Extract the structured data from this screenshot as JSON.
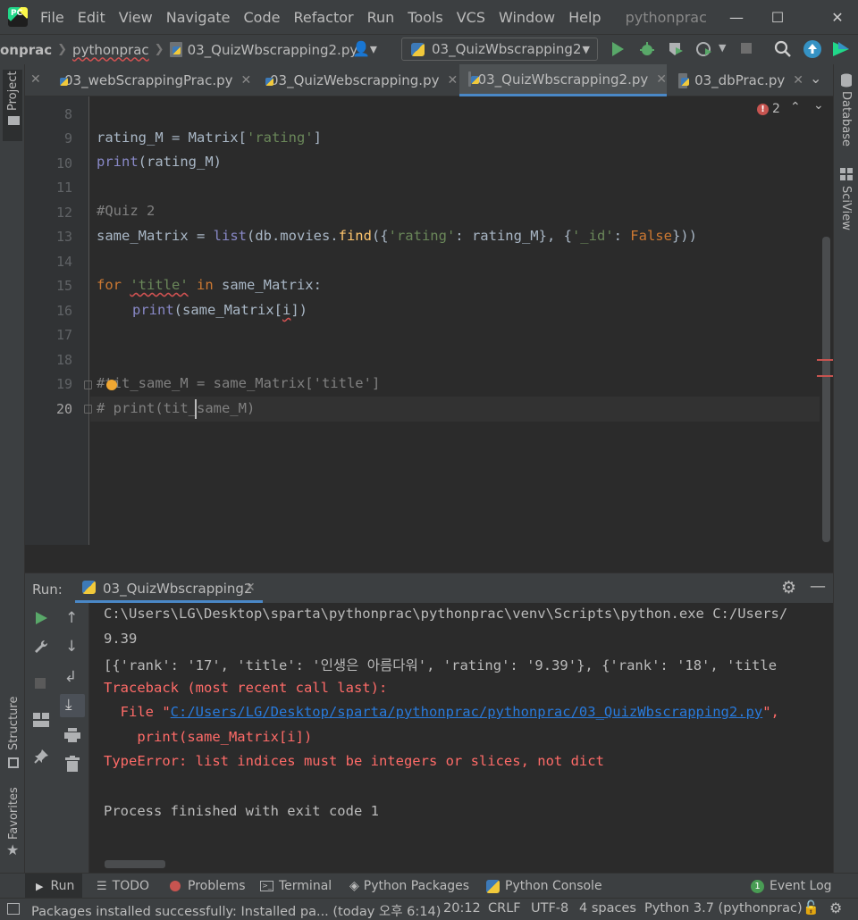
{
  "menubar": {
    "logo_text": "PC",
    "items": [
      "File",
      "Edit",
      "View",
      "Navigate",
      "Code",
      "Refactor",
      "Run",
      "Tools",
      "VCS",
      "Window",
      "Help"
    ],
    "mnemonics": [
      "F",
      "E",
      "V",
      "N",
      "C",
      "R",
      "R",
      "T",
      "V",
      "W",
      "H"
    ],
    "project_title": "pythonprac",
    "window_controls": [
      "minimize-icon",
      "maximize-icon",
      "close-icon"
    ]
  },
  "navbar": {
    "crumbs": [
      "onprac",
      "pythonprac",
      "03_QuizWbscrapping2.py"
    ],
    "run_config": "03_QuizWbscrapping2"
  },
  "left_strip": {
    "project_label": "Project",
    "structure_label": "Structure",
    "favorites_label": "Favorites"
  },
  "right_strip": {
    "database_label": "Database",
    "sciview_label": "SciView"
  },
  "tabs": [
    {
      "label": "03_webScrappingPrac.py"
    },
    {
      "label": "03_QuizWebscrapping.py"
    },
    {
      "label": "03_QuizWbscrapping2.py"
    },
    {
      "label": "03_dbPrac.py"
    }
  ],
  "editor": {
    "error_count": "2",
    "line_numbers": [
      "8",
      "9",
      "10",
      "11",
      "12",
      "13",
      "14",
      "15",
      "16",
      "17",
      "18",
      "19",
      "20"
    ],
    "current_line": "20",
    "code": {
      "l9": {
        "a": "rating_M = Matrix[",
        "b": "'rating'",
        "c": "]"
      },
      "l10": {
        "a": "print",
        "b": "(rating_M)"
      },
      "l12": "#Quiz 2",
      "l13": {
        "a": "same_Matrix = ",
        "b": "list",
        "c": "(db.movies.",
        "d": "find",
        "e": "({",
        "f": "'rating'",
        "g": ": rating_M}, {",
        "h": "'_id'",
        "i": ": ",
        "j": "False",
        "k": "}))"
      },
      "l15": {
        "a": "for ",
        "b": "'title'",
        "c": " in ",
        "d": "same_Matrix:"
      },
      "l16": {
        "a": "print",
        "b": "(same_Matrix[",
        "c": "i",
        "d": "])"
      },
      "l19": "#tit_same_M = same_Matrix['title']",
      "l20": "# print(tit_same_M)"
    }
  },
  "run_panel": {
    "label": "Run:",
    "tab_label": "03_QuizWbscrapping2",
    "console": {
      "cmd": "C:\\Users\\LG\\Desktop\\sparta\\pythonprac\\pythonprac\\venv\\Scripts\\python.exe C:/Users/",
      "out1": "9.39",
      "out2": "[{'rank': '17', 'title': '인생은 아름다워', 'rating': '9.39'}, {'rank': '18', 'title",
      "tb": "Traceback (most recent call last):",
      "file_pre": "  File \"",
      "file_link": "C:/Users/LG/Desktop/sparta/pythonprac/pythonprac/03_QuizWbscrapping2.py",
      "file_post": "\",",
      "src": "    print(same_Matrix[i])",
      "type_error": "TypeError: list indices must be integers or slices, not dict",
      "finished": "Process finished with exit code 1"
    }
  },
  "bottom_tools": {
    "run": "Run",
    "todo": "TODO",
    "problems": "Problems",
    "terminal": "Terminal",
    "python_packages": "Python Packages",
    "python_console": "Python Console",
    "event_log": "Event Log",
    "event_log_count": "1"
  },
  "statusbar": {
    "message": "Packages installed successfully: Installed pa... (today 오후 6:14)",
    "position": "20:12",
    "line_sep": "CRLF",
    "encoding": "UTF-8",
    "indent": "4 spaces",
    "interpreter": "Python 3.7 (pythonprac)"
  },
  "colors": {
    "accent": "#4a88c7",
    "error": "#ff6b68",
    "run_green": "#59a869",
    "link": "#287bde"
  }
}
